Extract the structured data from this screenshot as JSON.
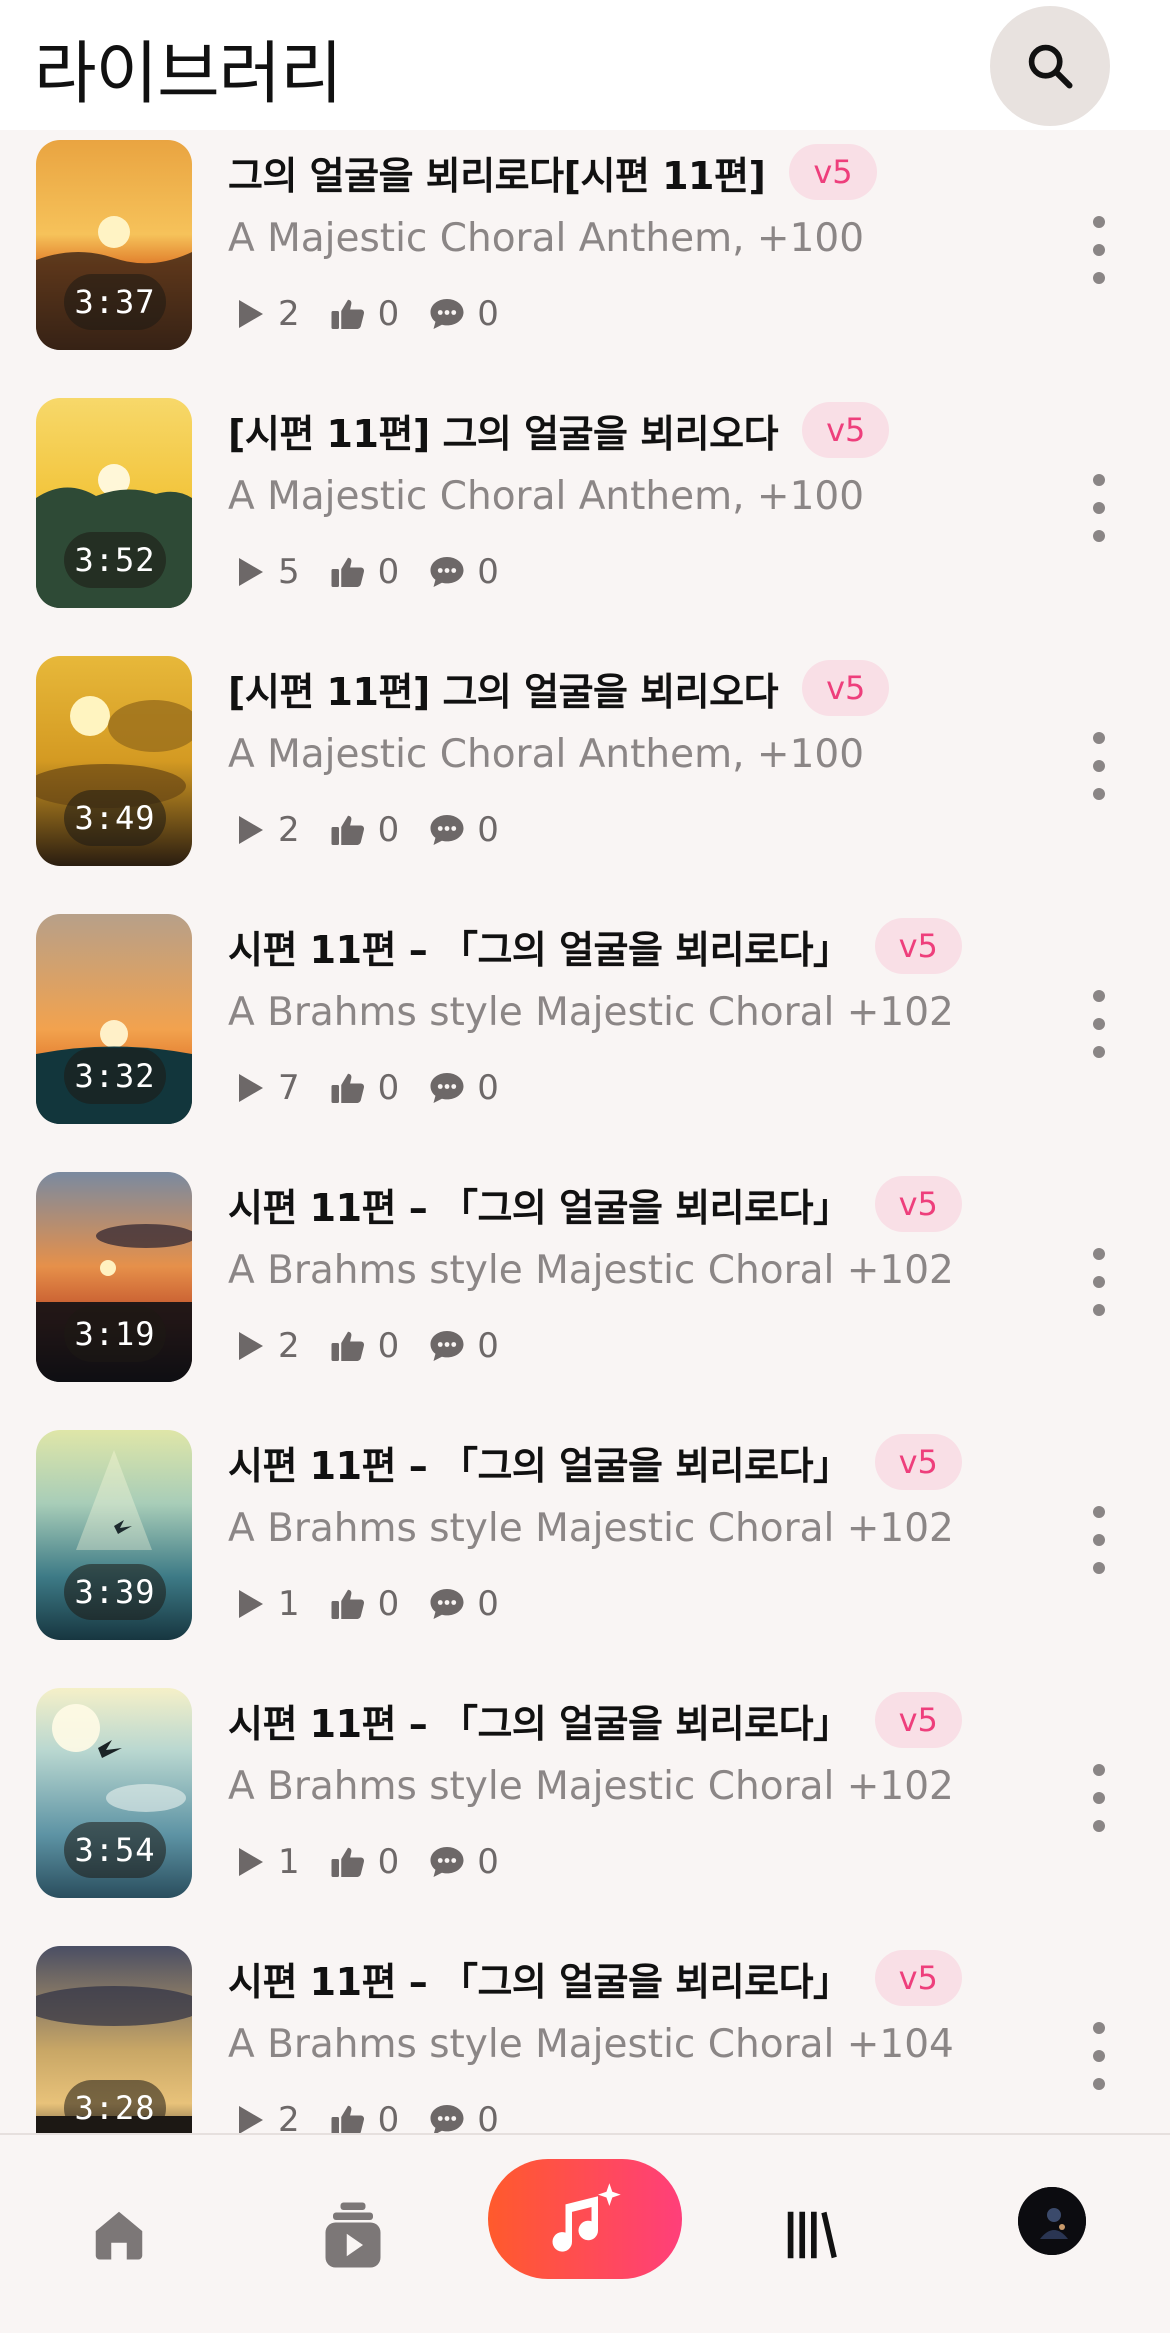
{
  "header": {
    "title": "라이브러리"
  },
  "songs": [
    {
      "title": "그의 얼굴을 뵈리로다[시편 11편]",
      "badge": "v5",
      "subtitle": "A Majestic Choral Anthem, +100",
      "duration": "3:37",
      "plays": "2",
      "likes": "0",
      "comments": "0",
      "thumb": "sunset-orange"
    },
    {
      "title": "[시편 11편] 그의 얼굴을 뵈리오다",
      "badge": "v5",
      "subtitle": "A Majestic Choral Anthem, +100",
      "duration": "3:52",
      "plays": "5",
      "likes": "0",
      "comments": "0",
      "thumb": "sun-yellow-hills"
    },
    {
      "title": "[시편 11편] 그의 얼굴을 뵈리오다",
      "badge": "v5",
      "subtitle": "A Majestic Choral Anthem, +100",
      "duration": "3:49",
      "plays": "2",
      "likes": "0",
      "comments": "0",
      "thumb": "sun-clouds-gold"
    },
    {
      "title": "시편 11편 – 「그의 얼굴을 뵈리로다」",
      "badge": "v5",
      "subtitle": "A Brahms style Majestic Choral +102",
      "duration": "3:32",
      "plays": "7",
      "likes": "0",
      "comments": "0",
      "thumb": "rays-orange"
    },
    {
      "title": "시편 11편 – 「그의 얼굴을 뵈리로다」",
      "badge": "v5",
      "subtitle": "A Brahms style Majestic Choral +102",
      "duration": "3:19",
      "plays": "2",
      "likes": "0",
      "comments": "0",
      "thumb": "sunset-dusk"
    },
    {
      "title": "시편 11편 – 「그의 얼굴을 뵈리로다」",
      "badge": "v5",
      "subtitle": "A Brahms style Majestic Choral +102",
      "duration": "3:39",
      "plays": "1",
      "likes": "0",
      "comments": "0",
      "thumb": "rays-teal-bird"
    },
    {
      "title": "시편 11편 – 「그의 얼굴을 뵈리로다」",
      "badge": "v5",
      "subtitle": "A Brahms style Majestic Choral +102",
      "duration": "3:54",
      "plays": "1",
      "likes": "0",
      "comments": "0",
      "thumb": "sky-blue-bird"
    },
    {
      "title": "시편 11편 – 「그의 얼굴을 뵈리로다」",
      "badge": "v5",
      "subtitle": "A Brahms style Majestic Choral +104",
      "duration": "3:28",
      "plays": "2",
      "likes": "0",
      "comments": "0",
      "thumb": "dusk-gold"
    }
  ],
  "icons": {
    "search": "search-icon",
    "play": "play-icon",
    "like": "thumbs-up-icon",
    "comment": "comment-icon",
    "more": "more-vertical-icon",
    "home": "home-icon",
    "feed": "video-stack-icon",
    "create": "music-sparkle-icon",
    "library": "library-icon",
    "profile": "avatar"
  },
  "colors": {
    "accent": "#ff3f7a",
    "accent_start": "#ff5a2c",
    "badge_bg": "#f9dfe6",
    "badge_text": "#ee3f7c"
  }
}
